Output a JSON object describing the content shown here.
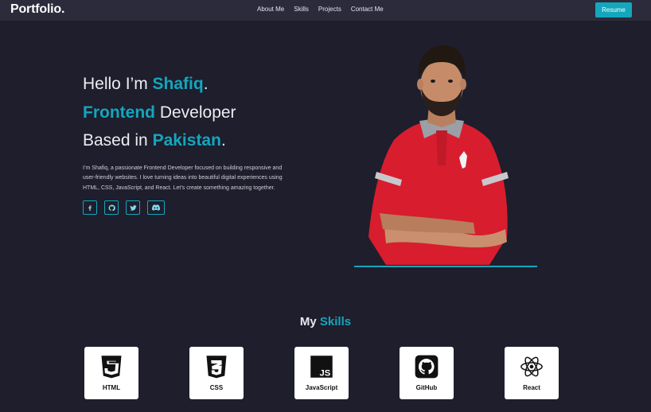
{
  "nav": {
    "logo": "Portfolio.",
    "links": [
      "About Me",
      "Skills",
      "Projects",
      "Contact Me"
    ],
    "resume_label": "Resume"
  },
  "hero": {
    "line1_pre": "Hello I’m ",
    "line1_name": "Shafiq",
    "line1_post": ".",
    "line2_accent": "Frontend",
    "line2_post": " Developer",
    "line3_pre": "Based in ",
    "line3_place": "Pakistan",
    "line3_post": ".",
    "intro": "I’m Shafiq, a passionate Frontend Developer focused on building responsive and user-friendly websites. I love turning ideas into beautiful digital experiences using HTML, CSS, JavaScript, and React. Let’s create something amazing together.",
    "socials": [
      "facebook-icon",
      "github-icon",
      "twitter-icon",
      "discord-icon"
    ]
  },
  "skills": {
    "title_pre": "My",
    "title_accent": "Skills",
    "items": [
      "HTML",
      "CSS",
      "JavaScript",
      "GitHub",
      "React"
    ]
  },
  "colors": {
    "accent": "#14a6bc",
    "background": "#1e1e2d",
    "navbar": "#2b2b3b",
    "card": "#ffffff"
  }
}
